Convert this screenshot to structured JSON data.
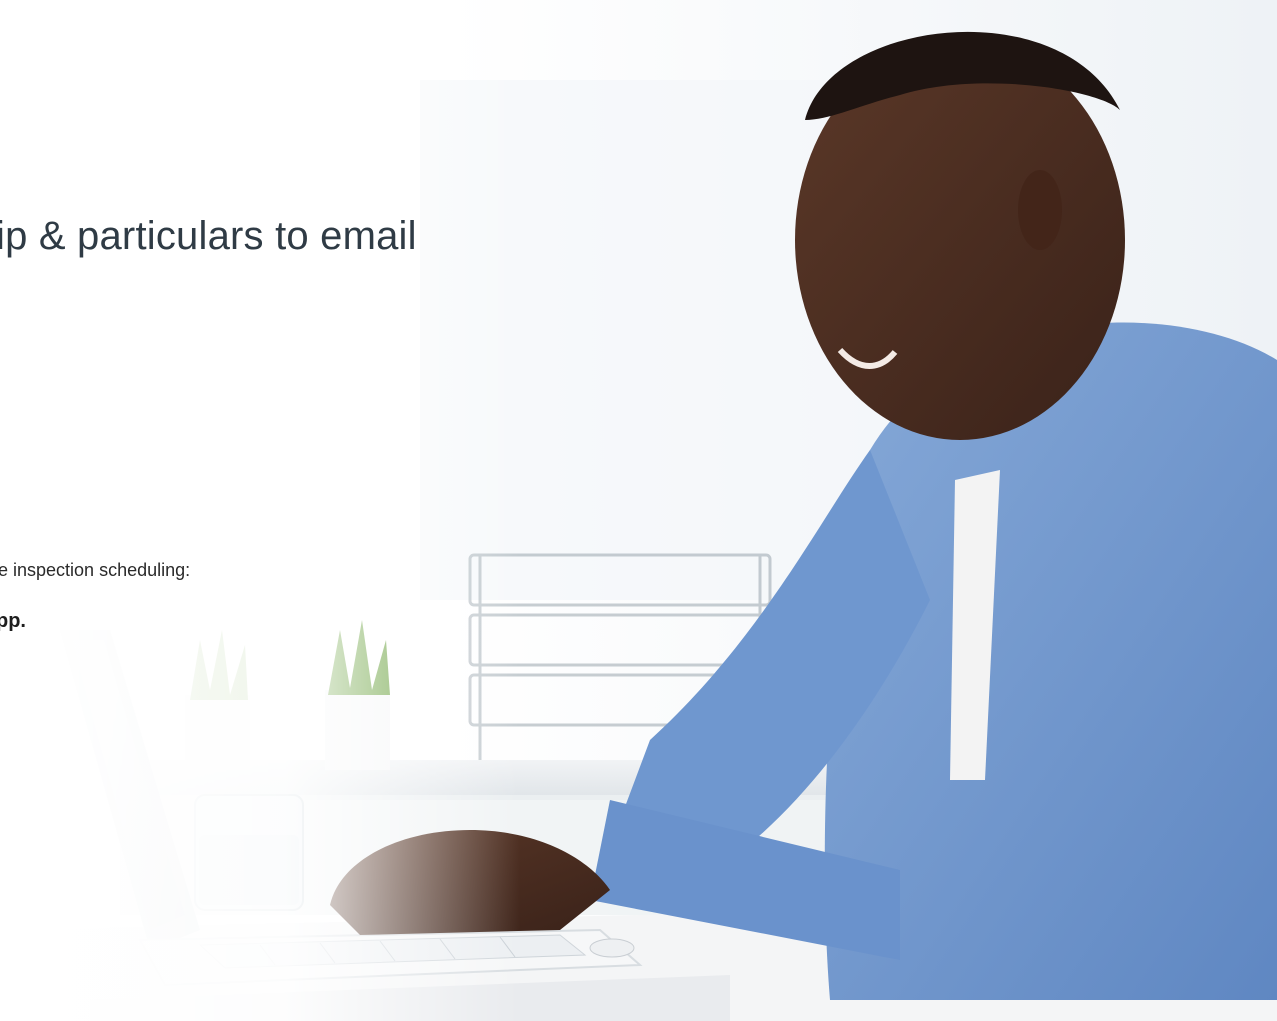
{
  "headline": "ip & particulars to email",
  "body_line": "e inspection scheduling:",
  "emphasis_line": "pp.",
  "scene": {
    "description_icon": "man-typing-laptop-photo",
    "shirt_color": "#6f97cf",
    "skin_color": "#4a2d22",
    "background_color": "#f4f7fa"
  }
}
